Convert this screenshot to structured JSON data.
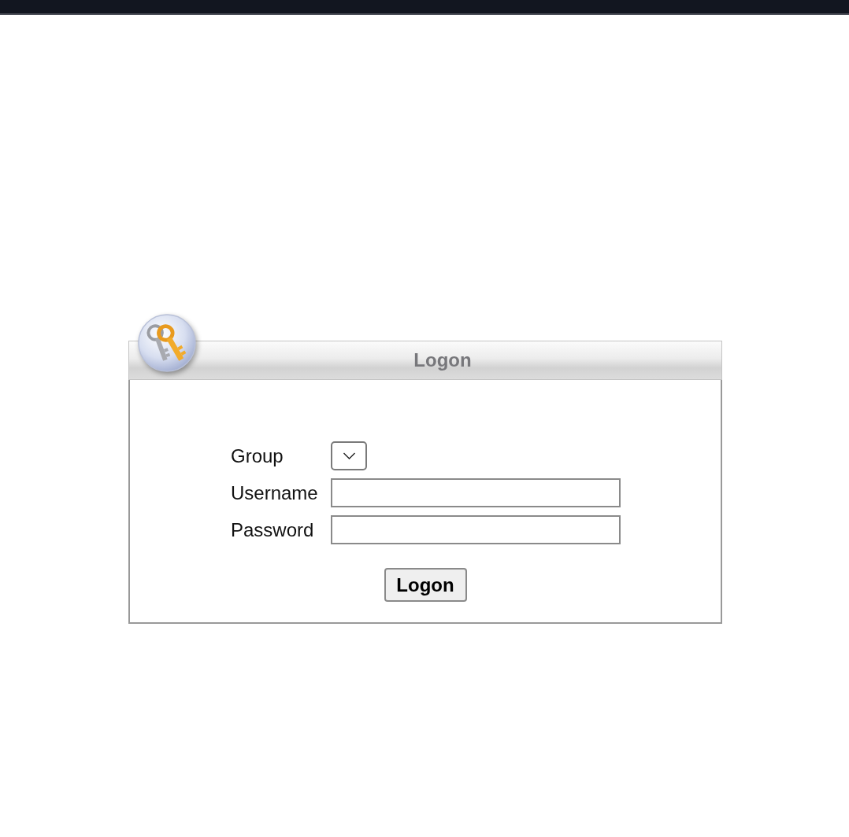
{
  "panel": {
    "title": "Logon"
  },
  "form": {
    "fields": [
      {
        "kind": "select",
        "label": "Group"
      },
      {
        "kind": "text",
        "label": "Username"
      },
      {
        "kind": "password",
        "label": "Password"
      }
    ]
  },
  "submit_button": {
    "label": "Logon"
  }
}
